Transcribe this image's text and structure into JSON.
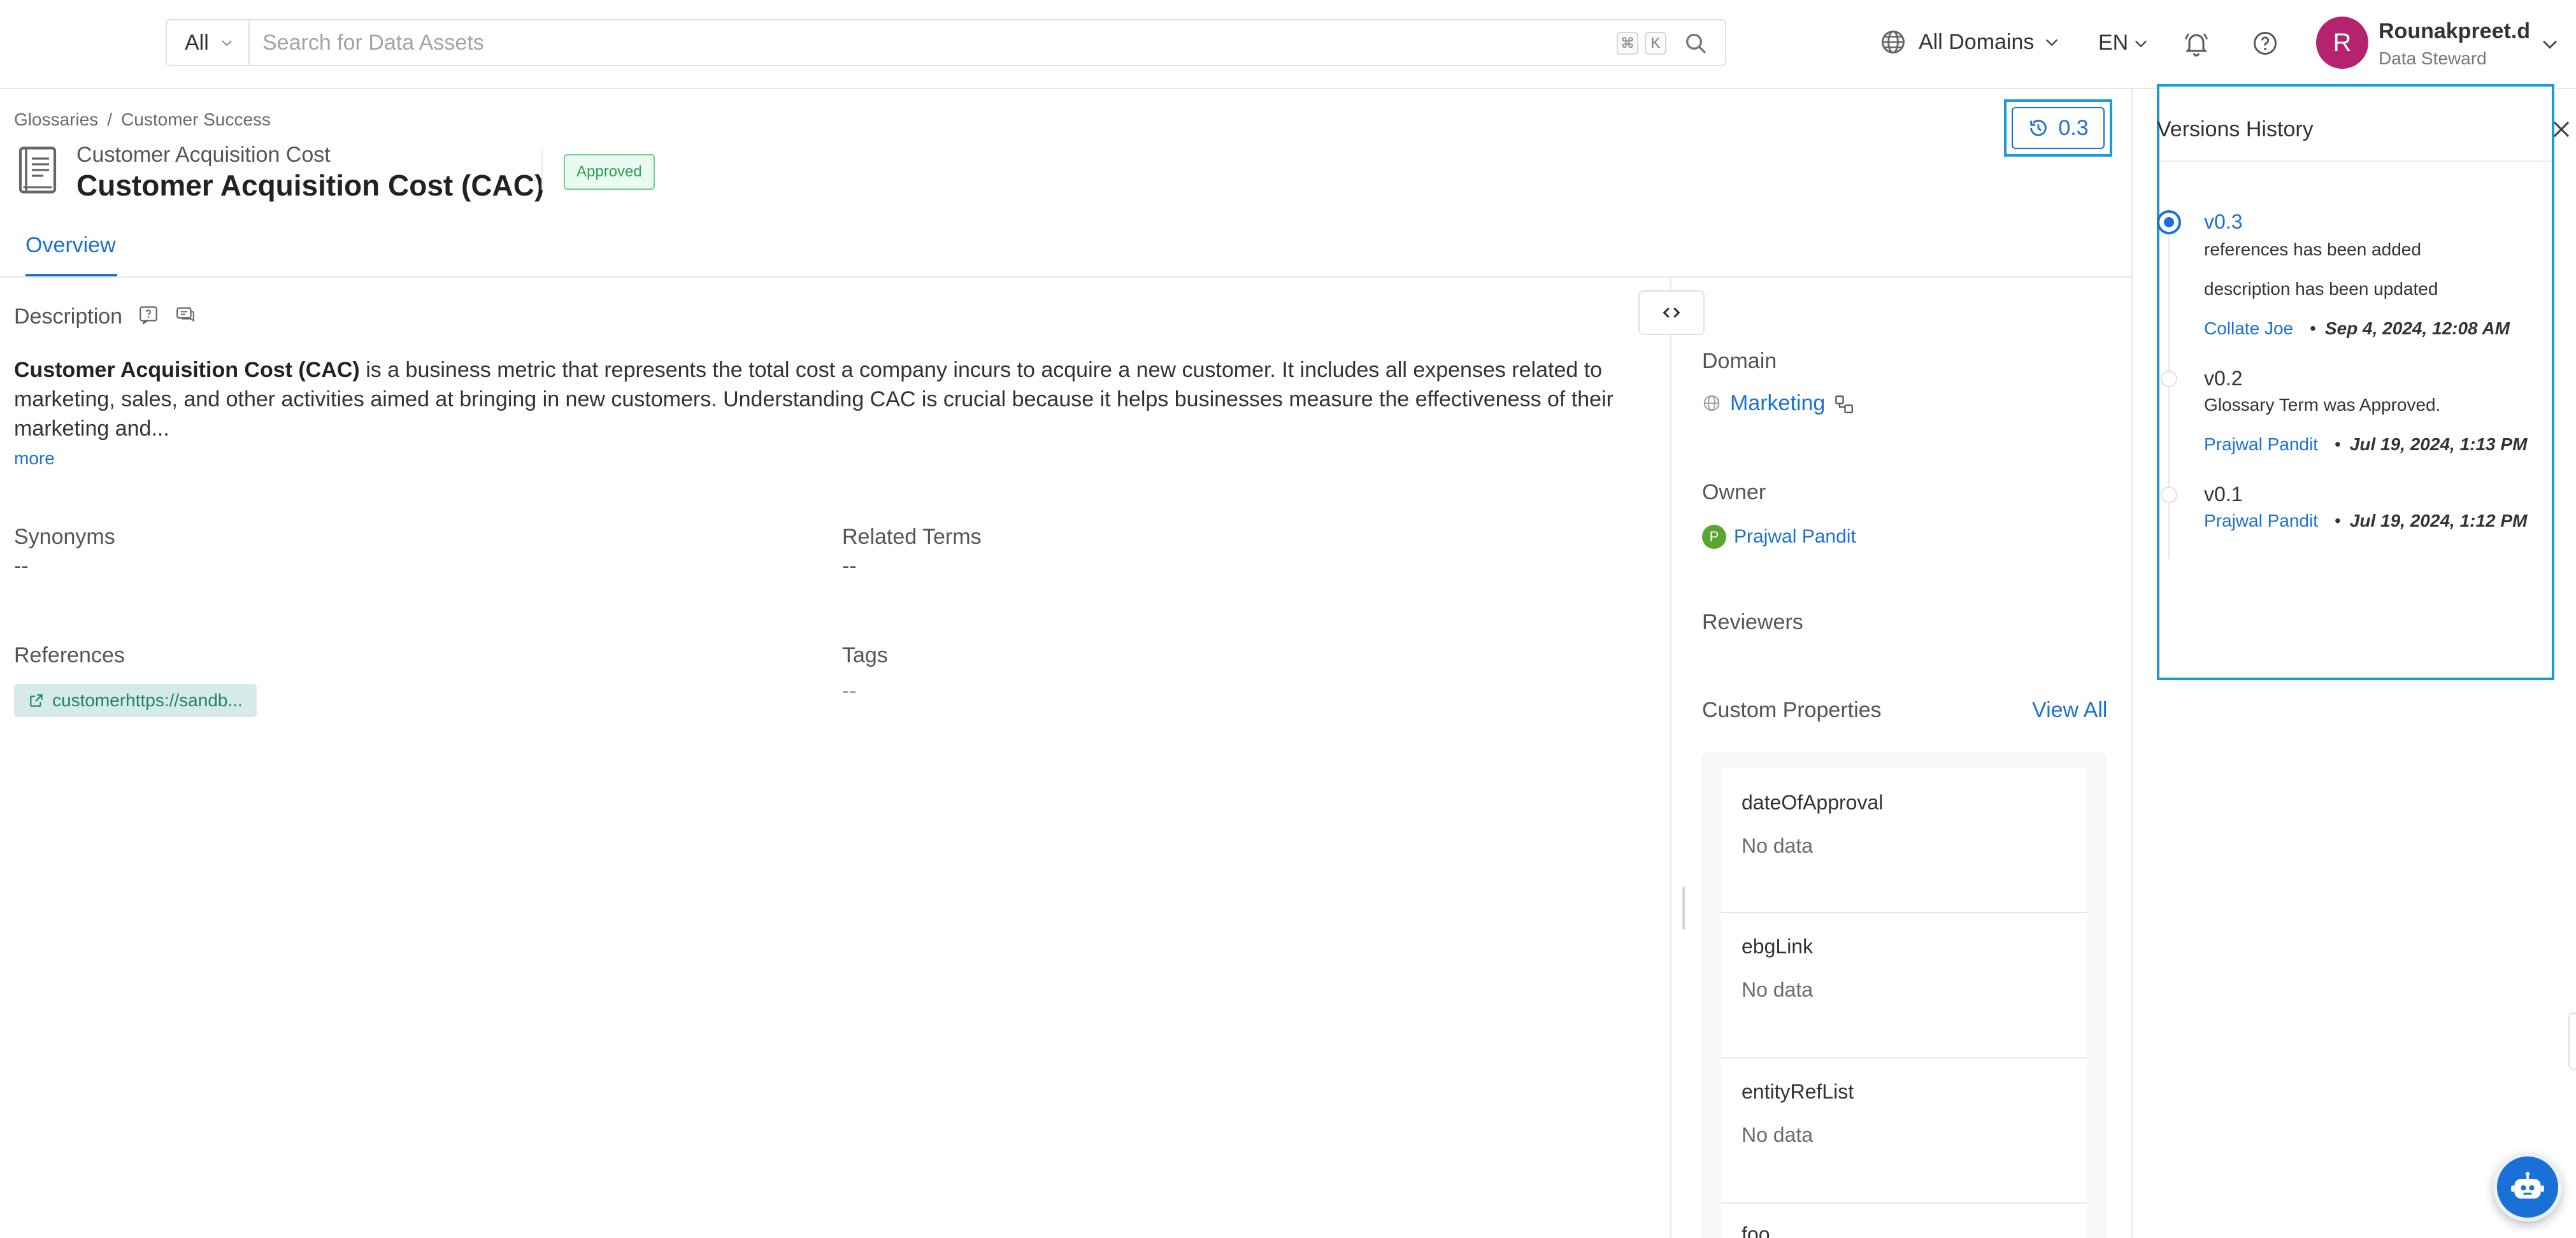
{
  "search": {
    "type_label": "All",
    "placeholder": "Search for Data Assets",
    "shortcut_keys": [
      "⌘",
      "K"
    ]
  },
  "topnav": {
    "domains_label": "All Domains",
    "language": "EN",
    "user": {
      "initial": "R",
      "name": "Rounakpreet.d",
      "role": "Data Steward",
      "avatar_color": "#b5236f"
    }
  },
  "breadcrumb": {
    "items": [
      "Glossaries",
      "Customer Success"
    ],
    "separator": "/"
  },
  "term": {
    "display_name": "Customer Acquisition Cost",
    "name": "Customer Acquisition Cost (CAC)",
    "status": "Approved",
    "version": "0.3"
  },
  "tabs": [
    {
      "label": "Overview",
      "active": true
    }
  ],
  "description": {
    "label": "Description",
    "bold_lead": "Customer Acquisition Cost (CAC)",
    "line1_rest": " is a business metric that represents the total cost a company incurs to acquire a new customer. It includes all expenses related to",
    "line2": "marketing, sales, and other activities aimed at bringing in new customers. Understanding CAC is crucial because it helps businesses measure the effectiveness of their",
    "line3": "marketing and...",
    "more_label": "more"
  },
  "fields": {
    "synonyms_label": "Synonyms",
    "synonyms_value": "--",
    "related_terms_label": "Related Terms",
    "related_terms_value": "--",
    "references_label": "References",
    "reference_link": "customerhttps://sandb...",
    "tags_label": "Tags",
    "tags_value": "--"
  },
  "sidebar": {
    "domain_label": "Domain",
    "domain_value": "Marketing",
    "owner_label": "Owner",
    "owner_initial": "P",
    "owner_name": "Prajwal Pandit",
    "reviewers_label": "Reviewers",
    "custom_properties_label": "Custom Properties",
    "view_all_label": "View All",
    "custom_properties": [
      {
        "name": "dateOfApproval",
        "value": "No data"
      },
      {
        "name": "ebgLink",
        "value": "No data"
      },
      {
        "name": "entityRefList",
        "value": "No data"
      },
      {
        "name": "foo",
        "value": ""
      }
    ]
  },
  "versions_history": {
    "title": "Versions History",
    "versions": [
      {
        "version": "v0.3",
        "active": true,
        "notes": [
          "references has been added",
          "description has been updated"
        ],
        "author": "Collate Joe",
        "date": "Sep 4, 2024, 12:08 AM"
      },
      {
        "version": "v0.2",
        "active": false,
        "notes": [
          "Glossary Term was Approved."
        ],
        "author": "Prajwal Pandit",
        "date": "Jul 19, 2024, 1:13 PM"
      },
      {
        "version": "v0.1",
        "active": false,
        "notes": [],
        "author": "Prajwal Pandit",
        "date": "Jul 19, 2024, 1:12 PM"
      }
    ]
  },
  "colors": {
    "accent": "#1a70d6",
    "highlight_border": "#1a9bd7",
    "approved_green": "#2e9e5b",
    "reference_chip": "#d6ebe8"
  },
  "icons": {
    "search": "search-icon",
    "globe": "globe-icon",
    "bell": "bell-icon",
    "help": "help-icon",
    "history": "history-icon",
    "close": "close-icon",
    "glossary_term": "book-icon",
    "external_link": "external-link-icon",
    "code_toggle": "code-icon",
    "chatbot": "bot-icon"
  }
}
